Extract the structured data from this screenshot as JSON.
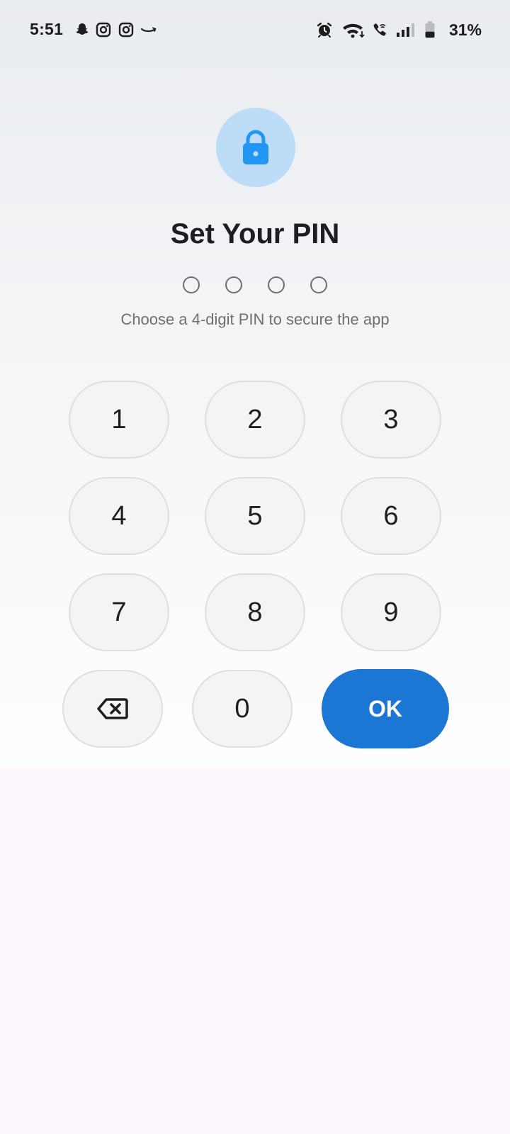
{
  "status_bar": {
    "time": "5:51",
    "battery": "31%",
    "left_icons": [
      "snapchat-icon",
      "instagram-icon",
      "instagram-icon",
      "amazon-icon"
    ],
    "right_icons": [
      "alarm-icon",
      "wifi-icon",
      "wifi-call-icon",
      "signal-icon",
      "battery-icon"
    ]
  },
  "lock": {
    "icon": "lock-icon",
    "circle_color": "#bcdcf8",
    "icon_color": "#2196f3"
  },
  "title": "Set Your PIN",
  "pin": {
    "length": 4,
    "entered": 0
  },
  "subtitle": "Choose a 4-digit PIN to secure the app",
  "keypad": {
    "keys": {
      "k1": "1",
      "k2": "2",
      "k3": "3",
      "k4": "4",
      "k5": "5",
      "k6": "6",
      "k7": "7",
      "k8": "8",
      "k9": "9",
      "k0": "0"
    },
    "backspace_icon": "backspace-icon",
    "ok_label": "OK",
    "ok_color": "#1c76d3"
  }
}
